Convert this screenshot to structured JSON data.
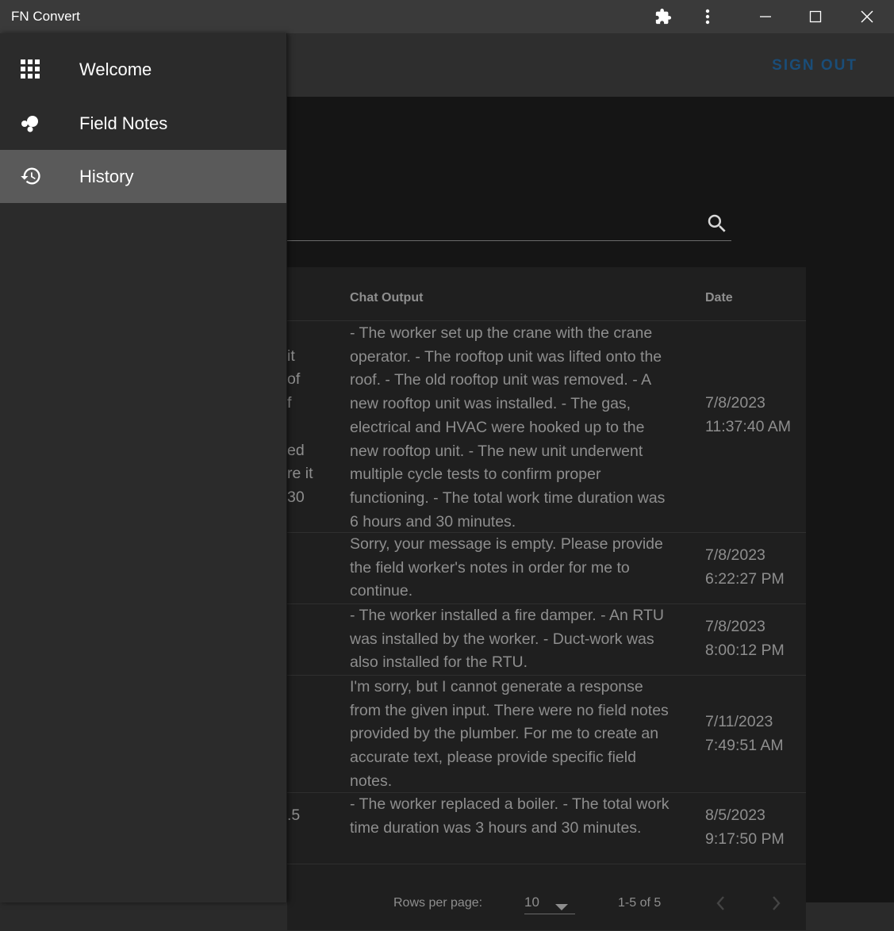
{
  "window": {
    "title": "FN Convert"
  },
  "appbar": {
    "sign_out": "SIGN OUT"
  },
  "nav": {
    "items": [
      {
        "label": "Welcome",
        "icon": "apps-grid-icon"
      },
      {
        "label": "Field Notes",
        "icon": "bubbles-icon"
      },
      {
        "label": "History",
        "icon": "history-icon",
        "active": true
      }
    ]
  },
  "table": {
    "headers": {
      "output": "Chat Output",
      "date": "Date"
    },
    "rows": [
      {
        "left": [
          "",
          "it",
          "of",
          "f",
          "",
          "ed",
          "re it",
          "30",
          ""
        ],
        "output": "- The worker set up the crane with the crane operator. - The rooftop unit was lifted onto the roof. - The old rooftop unit was removed. - A new rooftop unit was installed. - The gas, electrical and HVAC were hooked up to the new rooftop unit. - The new unit underwent multiple cycle tests to confirm proper functioning. - The total work time duration was 6 hours and 30 minutes.",
        "date": "7/8/2023 11:37:40 AM"
      },
      {
        "left": [],
        "output": "Sorry, your message is empty. Please provide the field worker's notes in order for me to continue.",
        "date": "7/8/2023 6:22:27 PM"
      },
      {
        "left": [],
        "output": "- The worker installed a fire damper. - An RTU was installed by the worker. - Duct-work was also installed for the RTU.",
        "date": "7/8/2023 8:00:12 PM"
      },
      {
        "left": [],
        "output": "I'm sorry, but I cannot generate a response from the given input. There were no field notes provided by the plumber. For me to create an accurate text, please provide specific field notes.",
        "date": "7/11/2023 7:49:51 AM"
      },
      {
        "left": [
          ".5"
        ],
        "output": "- The worker replaced a boiler. - The total work time duration was 3 hours and 30 minutes.",
        "date": "8/5/2023 9:17:50 PM"
      }
    ]
  },
  "pagination": {
    "rows_per_page_label": "Rows per page:",
    "rows_per_page": "10",
    "range": "1-5 of 5"
  },
  "colors": {
    "accent": "#1a4d78",
    "active_nav": "#5a5a5a"
  }
}
